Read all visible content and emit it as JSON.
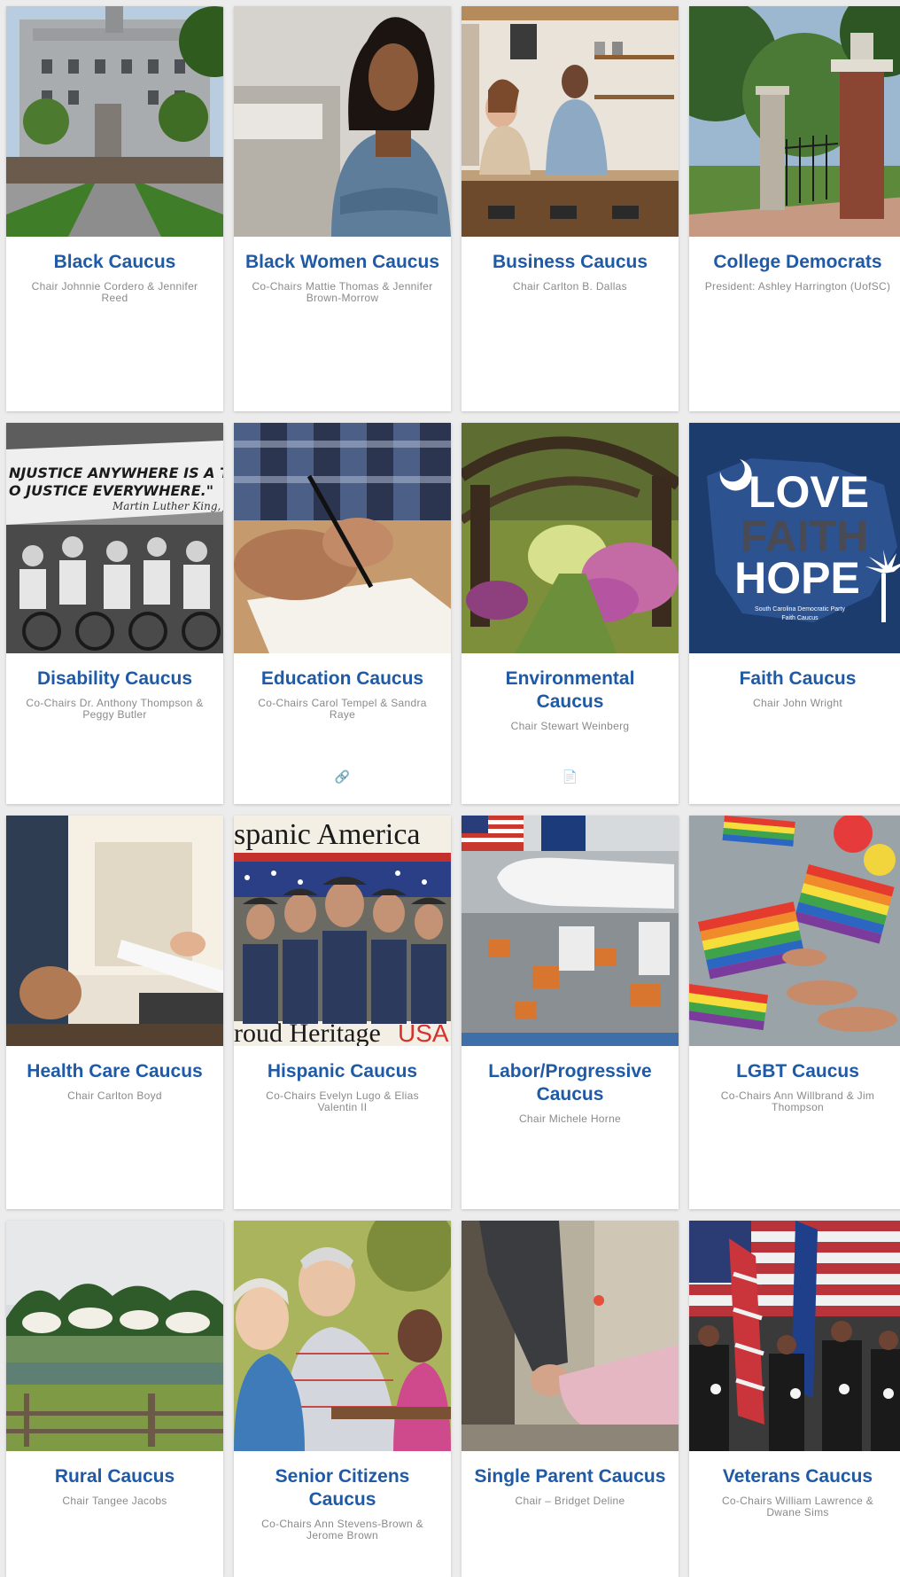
{
  "cards": [
    {
      "title": "Black Caucus",
      "sub": "Chair Johnnie Cordero & Jennifer Reed",
      "photo": "state-house-photo"
    },
    {
      "title": "Black Women Caucus",
      "sub": "Co-Chairs Mattie Thomas & Jennifer Brown-Morrow",
      "photo": "woman-portrait-photo"
    },
    {
      "title": "Business Caucus",
      "sub": "Chair Carlton B. Dallas",
      "photo": "coffee-shop-owners-photo"
    },
    {
      "title": "College Democrats",
      "sub": "President: Ashley Harrington (UofSC)",
      "photo": "campus-gate-photo"
    },
    {
      "title": "Disability Caucus",
      "sub": "Co-Chairs Dr. Anthony Thompson & Peggy Butler",
      "photo": "civil-rights-march-photo"
    },
    {
      "title": "Education Caucus",
      "sub": "Co-Chairs Carol Tempel & Sandra Raye",
      "photo": "writing-notebook-photo",
      "icon": "🔗",
      "icon_name": "link-icon"
    },
    {
      "title": "Environmental Caucus",
      "sub": "Chair Stewart Weinberg",
      "photo": "oak-alley-photo",
      "icon": "📄",
      "icon_name": "document-icon"
    },
    {
      "title": "Faith Caucus",
      "sub": "Chair John Wright",
      "photo": "faith-caucus-logo",
      "logo": {
        "love": "LOVE",
        "faith": "FAITH",
        "hope": "HOPE",
        "line1": "South Carolina Democratic Party",
        "line2": "Faith Caucus"
      }
    },
    {
      "title": "Health Care Caucus",
      "sub": "Chair Carlton Boyd",
      "photo": "health-consult-photo"
    },
    {
      "title": "Hispanic Caucus",
      "sub": "Co-Chairs Evelyn Lugo & Elias Valentin II",
      "photo": "hispanic-heritage-stamp",
      "stamp": {
        "top": "spanic America",
        "bottom": "roud Heritage",
        "usa": "USA"
      }
    },
    {
      "title": "Labor/Progressive Caucus",
      "sub": "Chair Michele Horne",
      "photo": "aircraft-factory-photo"
    },
    {
      "title": "LGBT Caucus",
      "sub": "Co-Chairs Ann Willbrand & Jim Thompson",
      "photo": "pride-flags-photo"
    },
    {
      "title": "Rural Caucus",
      "sub": "Chair Tangee Jacobs",
      "photo": "rural-pond-photo"
    },
    {
      "title": "Senior Citizens Caucus",
      "sub": "Co-Chairs Ann Stevens-Brown & Jerome Brown",
      "photo": "seniors-photo"
    },
    {
      "title": "Single Parent Caucus",
      "sub": "Chair – Bridget Deline",
      "photo": "parent-child-photo"
    },
    {
      "title": "Veterans Caucus",
      "sub": "Co-Chairs William Lawrence & Dwane Sims",
      "photo": "veterans-flags-photo"
    }
  ]
}
